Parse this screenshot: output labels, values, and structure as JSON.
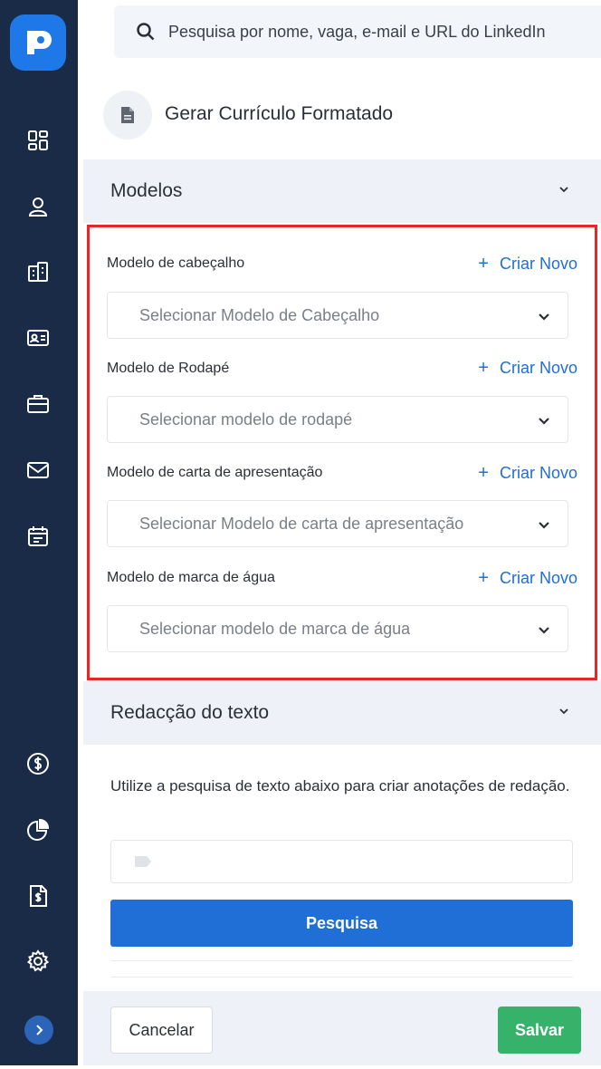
{
  "search": {
    "placeholder": "Pesquisa por nome, vaga, e-mail e URL do LinkedIn"
  },
  "sidebar": {
    "top_icons": [
      "dashboard-icon",
      "candidates-icon",
      "companies-icon",
      "contact-card-icon",
      "jobs-briefcase-icon",
      "mail-icon",
      "calendar-icon"
    ],
    "bottom_icons": [
      "billing-dollar-icon",
      "reports-pie-icon",
      "invoice-icon",
      "settings-gear-icon"
    ]
  },
  "panel": {
    "title": "Gerar Currículo Formatado",
    "models": {
      "heading": "Modelos",
      "fields": [
        {
          "label": "Modelo de cabeçalho",
          "create": "Criar Novo",
          "placeholder": "Selecionar Modelo de Cabeçalho"
        },
        {
          "label": "Modelo de Rodapé",
          "create": "Criar Novo",
          "placeholder": "Selecionar modelo de rodapé"
        },
        {
          "label": "Modelo de carta de apresentação",
          "create": "Criar Novo",
          "placeholder": "Selecionar Modelo de carta de apresentação"
        },
        {
          "label": "Modelo de marca de água",
          "create": "Criar Novo",
          "placeholder": "Selecionar modelo de marca de água"
        }
      ]
    },
    "redaction": {
      "heading": "Redacção do texto",
      "help": "Utilize a pesquisa de texto abaixo para criar anotações de redação.",
      "search_button": "Pesquisa"
    },
    "footer": {
      "cancel": "Cancelar",
      "save": "Salvar"
    }
  },
  "colors": {
    "sidebar": "#1a2b47",
    "accent": "#1f6fd6",
    "save": "#36b26a",
    "highlight": "#e8262a"
  }
}
